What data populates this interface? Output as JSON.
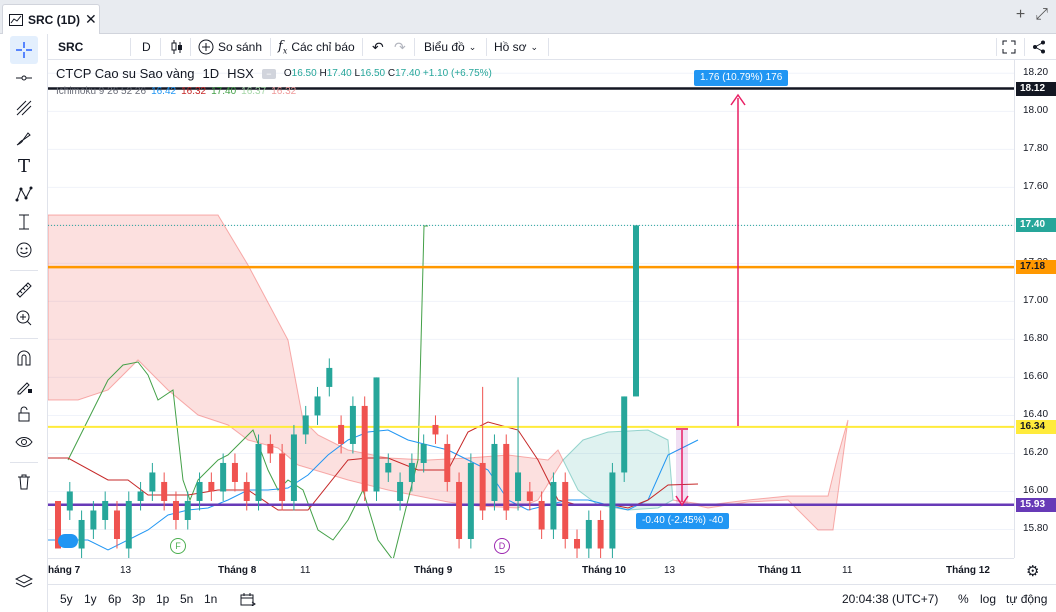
{
  "tab": {
    "title": "SRC (1D)"
  },
  "toolbar": {
    "symbol": "SRC",
    "interval": "D",
    "compare_label": "So sánh",
    "indicators_label": "Các chỉ báo",
    "chart_type_label": "Biểu đồ",
    "profile_label": "Hồ sơ"
  },
  "legend": {
    "title": "CTCP Cao su Sao vàng",
    "interval": "1D",
    "exchange": "HSX",
    "open_label": "O",
    "open": "16.50",
    "high_label": "H",
    "high": "17.40",
    "low_label": "L",
    "low": "16.50",
    "close_label": "C",
    "close": "17.40",
    "change": "+1.10 (+6.75%)",
    "indicator_name": "Ichimoku 9 26 52 26",
    "ind_v1": "16.42",
    "ind_v2": "16.32",
    "ind_v3": "17.40",
    "ind_v4": "16.37",
    "ind_v5": "16.32"
  },
  "measure_up": {
    "label": "1.76 (10.79%) 176"
  },
  "measure_down": {
    "label": "-0.40 (-2.45%) -40"
  },
  "price_ticks": [
    "18.20",
    "18.00",
    "17.80",
    "17.60",
    "17.40",
    "17.20",
    "17.00",
    "16.80",
    "16.60",
    "16.40",
    "16.20",
    "16.00",
    "15.80"
  ],
  "price_tags": [
    {
      "value": "18.12",
      "bg": "#131722",
      "fg": "#ffffff"
    },
    {
      "value": "17.40",
      "bg": "#26a69a",
      "fg": "#ffffff"
    },
    {
      "value": "17.18",
      "bg": "#ff9800",
      "fg": "#131722"
    },
    {
      "value": "16.34",
      "bg": "#ffeb3b",
      "fg": "#131722"
    },
    {
      "value": "15.93",
      "bg": "#673ab7",
      "fg": "#ffffff"
    }
  ],
  "time_ticks": [
    {
      "label": "háng 7",
      "major": true
    },
    {
      "label": "13",
      "major": false
    },
    {
      "label": "Tháng 8",
      "major": true
    },
    {
      "label": "11",
      "major": false
    },
    {
      "label": "Tháng 9",
      "major": true
    },
    {
      "label": "15",
      "major": false
    },
    {
      "label": "Tháng 10",
      "major": true
    },
    {
      "label": "13",
      "major": false
    },
    {
      "label": "Tháng 11",
      "major": true
    },
    {
      "label": "11",
      "major": false
    },
    {
      "label": "Tháng 12",
      "major": true
    }
  ],
  "ranges": [
    "5y",
    "1y",
    "6p",
    "3p",
    "1p",
    "5n",
    "1n"
  ],
  "bottom": {
    "time": "20:04:38 (UTC+7)",
    "percent": "%",
    "log": "log",
    "auto": "tự động"
  },
  "events": {
    "f": "F",
    "d": "D"
  },
  "colors": {
    "up": "#26a69a",
    "down": "#ef5350"
  },
  "chart_data": {
    "type": "candlestick",
    "ylim": [
      15.65,
      18.27
    ],
    "horizontal_lines": [
      18.12,
      17.18,
      16.34,
      15.93
    ],
    "last_price": 17.4,
    "candles": [
      [
        15.95,
        15.7,
        15.95,
        15.7
      ],
      [
        15.9,
        16.0,
        16.05,
        15.85
      ],
      [
        15.7,
        15.85,
        15.9,
        15.65
      ],
      [
        15.8,
        15.9,
        15.95,
        15.75
      ],
      [
        15.85,
        15.95,
        16.0,
        15.8
      ],
      [
        15.9,
        15.75,
        15.95,
        15.7
      ],
      [
        15.7,
        15.95,
        16.0,
        15.65
      ],
      [
        15.95,
        16.0,
        16.05,
        15.9
      ],
      [
        16.0,
        16.1,
        16.15,
        15.95
      ],
      [
        16.05,
        15.95,
        16.1,
        15.9
      ],
      [
        15.95,
        15.85,
        16.0,
        15.8
      ],
      [
        15.85,
        15.95,
        16.0,
        15.8
      ],
      [
        15.95,
        16.05,
        16.1,
        15.9
      ],
      [
        16.05,
        16.0,
        16.1,
        15.95
      ],
      [
        16.0,
        16.15,
        16.2,
        15.95
      ],
      [
        16.15,
        16.05,
        16.2,
        16.0
      ],
      [
        16.05,
        15.95,
        16.1,
        15.9
      ],
      [
        15.95,
        16.25,
        16.3,
        15.9
      ],
      [
        16.25,
        16.2,
        16.3,
        16.15
      ],
      [
        16.2,
        15.95,
        16.25,
        15.9
      ],
      [
        15.95,
        16.3,
        16.35,
        15.9
      ],
      [
        16.3,
        16.4,
        16.45,
        16.25
      ],
      [
        16.4,
        16.5,
        16.55,
        16.35
      ],
      [
        16.55,
        16.65,
        16.7,
        16.5
      ],
      [
        16.35,
        16.25,
        16.4,
        16.2
      ],
      [
        16.25,
        16.45,
        16.5,
        16.2
      ],
      [
        16.45,
        16.0,
        16.5,
        15.95
      ],
      [
        16.0,
        16.6,
        16.6,
        15.95
      ],
      [
        16.1,
        16.15,
        16.2,
        16.05
      ],
      [
        15.95,
        16.05,
        16.1,
        15.9
      ],
      [
        16.05,
        16.15,
        16.2,
        16.0
      ],
      [
        16.15,
        16.25,
        16.3,
        16.1
      ],
      [
        16.35,
        16.3,
        16.4,
        16.25
      ],
      [
        16.25,
        16.05,
        16.3,
        16.0
      ],
      [
        16.05,
        15.75,
        16.1,
        15.7
      ],
      [
        15.75,
        16.15,
        16.2,
        15.7
      ],
      [
        16.15,
        15.9,
        16.55,
        15.85
      ],
      [
        15.95,
        16.25,
        16.3,
        15.9
      ],
      [
        16.25,
        15.9,
        16.3,
        15.85
      ],
      [
        15.95,
        16.1,
        16.6,
        15.9
      ],
      [
        16.0,
        15.95,
        16.05,
        15.9
      ],
      [
        15.95,
        15.8,
        16.0,
        15.75
      ],
      [
        15.8,
        16.05,
        16.1,
        15.75
      ],
      [
        16.05,
        15.75,
        16.1,
        15.7
      ],
      [
        15.75,
        15.7,
        15.8,
        15.65
      ],
      [
        15.7,
        15.85,
        15.9,
        15.65
      ],
      [
        15.85,
        15.7,
        15.9,
        15.65
      ],
      [
        15.7,
        16.1,
        16.15,
        15.65
      ],
      [
        16.1,
        16.5,
        16.5,
        16.05
      ],
      [
        16.5,
        17.4,
        17.4,
        16.5
      ]
    ]
  }
}
